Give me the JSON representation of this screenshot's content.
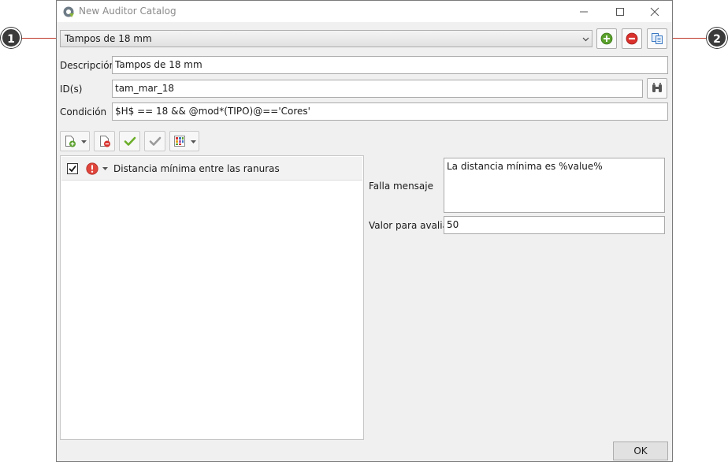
{
  "window": {
    "title": "New Auditor Catalog"
  },
  "callouts": {
    "first": "1",
    "second": "2"
  },
  "catalog_selector": {
    "value": "Tampos de 18 mm"
  },
  "form": {
    "description_label": "Descripción",
    "description_value": "Tampos de 18 mm",
    "ids_label": "ID(s)",
    "ids_value": "tam_mar_18",
    "condition_label": "Condición",
    "condition_value": "$H$ == 18 && @mod*(TIPO)@=='Cores'"
  },
  "rules": [
    {
      "checked": true,
      "severity": "error",
      "label": "Distancia mínima entre las ranuras"
    }
  ],
  "details": {
    "fail_message_label": "Falla mensaje",
    "fail_message_value": "La distancia mínima es %value%",
    "value_label": "Valor para avaliar",
    "value_value": "50"
  },
  "footer": {
    "ok_label": "OK"
  },
  "colors": {
    "callout_line": "#c0392b",
    "add": "#5aa02c",
    "remove": "#d9302c",
    "error": "#e0453c"
  }
}
